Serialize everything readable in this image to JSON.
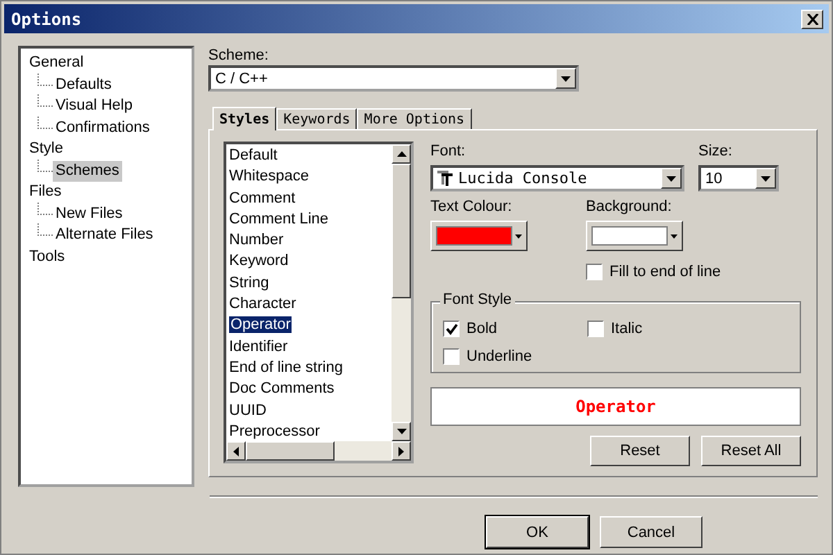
{
  "window": {
    "title": "Options"
  },
  "tree": [
    {
      "label": "General",
      "selected": false,
      "children": [
        {
          "label": "Defaults",
          "selected": false
        },
        {
          "label": "Visual Help",
          "selected": false
        },
        {
          "label": "Confirmations",
          "selected": false
        }
      ]
    },
    {
      "label": "Style",
      "selected": false,
      "children": [
        {
          "label": "Schemes",
          "selected": true
        }
      ]
    },
    {
      "label": "Files",
      "selected": false,
      "children": [
        {
          "label": "New Files",
          "selected": false
        },
        {
          "label": "Alternate Files",
          "selected": false
        }
      ]
    },
    {
      "label": "Tools",
      "selected": false
    }
  ],
  "scheme": {
    "label": "Scheme:",
    "value": "C / C++"
  },
  "tabs": [
    {
      "label": "Styles",
      "selected": true
    },
    {
      "label": "Keywords",
      "selected": false
    },
    {
      "label": "More Options",
      "selected": false
    }
  ],
  "styles": [
    {
      "label": "Default",
      "selected": false
    },
    {
      "label": "Whitespace",
      "selected": false
    },
    {
      "label": "Comment",
      "selected": false
    },
    {
      "label": "Comment Line",
      "selected": false
    },
    {
      "label": "Number",
      "selected": false
    },
    {
      "label": "Keyword",
      "selected": false
    },
    {
      "label": "String",
      "selected": false
    },
    {
      "label": "Character",
      "selected": false
    },
    {
      "label": "Operator",
      "selected": true
    },
    {
      "label": "Identifier",
      "selected": false
    },
    {
      "label": "End of line string",
      "selected": false
    },
    {
      "label": "Doc Comments",
      "selected": false
    },
    {
      "label": "UUID",
      "selected": false
    },
    {
      "label": "Preprocessor",
      "selected": false
    }
  ],
  "font": {
    "label": "Font:",
    "value": "Lucida Console"
  },
  "size": {
    "label": "Size:",
    "value": "10"
  },
  "text_colour": {
    "label": "Text Colour:",
    "color": "#ff0000"
  },
  "background": {
    "label": "Background:",
    "color": "#ffffff"
  },
  "fill_to_end": {
    "label": "Fill to end of line",
    "checked": false
  },
  "font_style": {
    "title": "Font Style",
    "options": [
      {
        "label": "Bold",
        "checked": true
      },
      {
        "label": "Italic",
        "checked": false
      },
      {
        "label": "Underline",
        "checked": false
      }
    ]
  },
  "preview": {
    "text": "Operator"
  },
  "buttons": [
    "Reset",
    "Reset All"
  ],
  "dialog_buttons": [
    "OK",
    "Cancel"
  ]
}
